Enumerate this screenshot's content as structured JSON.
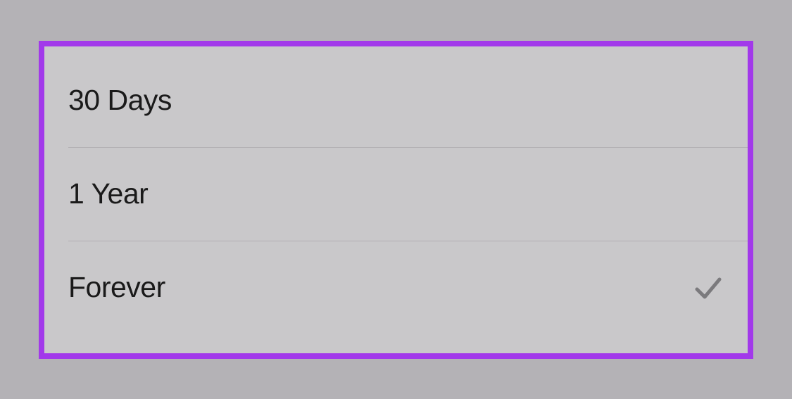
{
  "options": [
    {
      "label": "30 Days",
      "selected": false
    },
    {
      "label": "1 Year",
      "selected": false
    },
    {
      "label": "Forever",
      "selected": true
    }
  ],
  "colors": {
    "highlight_border": "#a239ea",
    "background": "#b4b2b6",
    "list_background": "#c9c8ca",
    "text": "#1a1a1a",
    "check": "#7b7a7d",
    "separator": "#b2afb3"
  }
}
